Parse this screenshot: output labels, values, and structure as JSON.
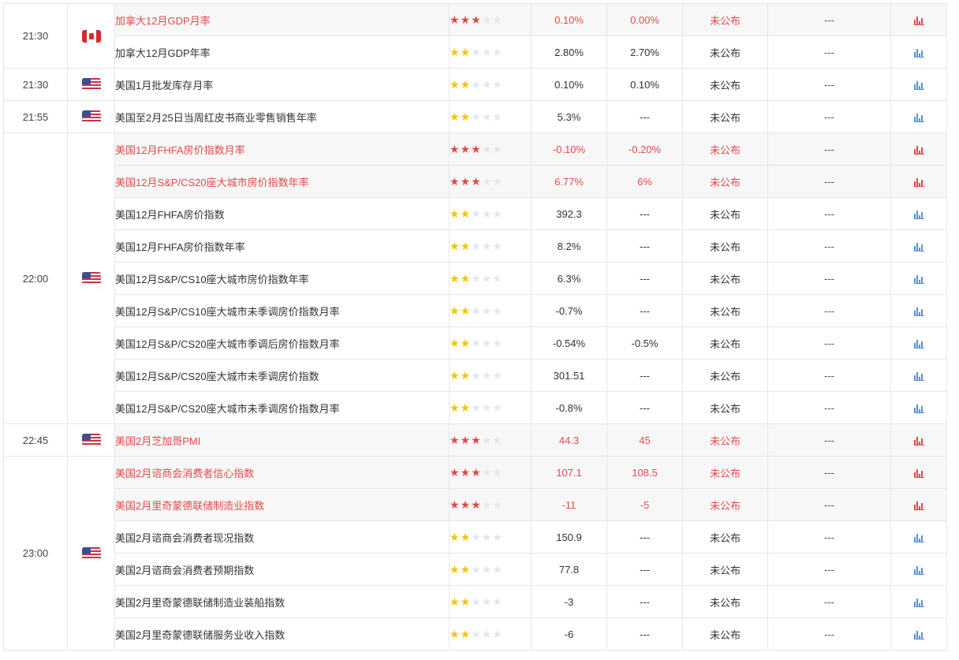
{
  "colors": {
    "highlight_text": "#e24b4b",
    "star_high": "#e34848",
    "star_mid": "#f5c400",
    "star_empty": "#e3e6ec",
    "chart_icon_high": "#e34848",
    "chart_icon_normal": "#5a8fe0",
    "row_highlight_bg": "#f7f7f7"
  },
  "groups": [
    {
      "time": "21:30",
      "flag": "canada-flag-icon",
      "rows": [
        {
          "name": "加拿大12月GDP月率",
          "stars": 3,
          "prev": "0.10%",
          "forecast": "0.00%",
          "actual": "未公布",
          "effect": "---",
          "important": true
        },
        {
          "name": "加拿大12月GDP年率",
          "stars": 2,
          "prev": "2.80%",
          "forecast": "2.70%",
          "actual": "未公布",
          "effect": "---",
          "important": false
        }
      ]
    },
    {
      "time": "21:30",
      "flag": "usa-flag-icon",
      "rows": [
        {
          "name": "美国1月批发库存月率",
          "stars": 2,
          "prev": "0.10%",
          "forecast": "0.10%",
          "actual": "未公布",
          "effect": "---",
          "important": false
        }
      ]
    },
    {
      "time": "21:55",
      "flag": "usa-flag-icon",
      "rows": [
        {
          "name": "美国至2月25日当周红皮书商业零售销售年率",
          "stars": 2,
          "prev": "5.3%",
          "forecast": "---",
          "actual": "未公布",
          "effect": "---",
          "important": false
        }
      ]
    },
    {
      "time": "22:00",
      "flag": "usa-flag-icon",
      "rows": [
        {
          "name": "美国12月FHFA房价指数月率",
          "stars": 3,
          "prev": "-0.10%",
          "forecast": "-0.20%",
          "actual": "未公布",
          "effect": "---",
          "important": true
        },
        {
          "name": "美国12月S&P/CS20座大城市房价指数年率",
          "stars": 3,
          "prev": "6.77%",
          "forecast": "6%",
          "actual": "未公布",
          "effect": "---",
          "important": true
        },
        {
          "name": "美国12月FHFA房价指数",
          "stars": 2,
          "prev": "392.3",
          "forecast": "---",
          "actual": "未公布",
          "effect": "---",
          "important": false
        },
        {
          "name": "美国12月FHFA房价指数年率",
          "stars": 2,
          "prev": "8.2%",
          "forecast": "---",
          "actual": "未公布",
          "effect": "---",
          "important": false
        },
        {
          "name": "美国12月S&P/CS10座大城市房价指数年率",
          "stars": 2,
          "prev": "6.3%",
          "forecast": "---",
          "actual": "未公布",
          "effect": "---",
          "important": false
        },
        {
          "name": "美国12月S&P/CS10座大城市未季调房价指数月率",
          "stars": 2,
          "prev": "-0.7%",
          "forecast": "---",
          "actual": "未公布",
          "effect": "---",
          "important": false
        },
        {
          "name": "美国12月S&P/CS20座大城市季调后房价指数月率",
          "stars": 2,
          "prev": "-0.54%",
          "forecast": "-0.5%",
          "actual": "未公布",
          "effect": "---",
          "important": false
        },
        {
          "name": "美国12月S&P/CS20座大城市未季调房价指数",
          "stars": 2,
          "prev": "301.51",
          "forecast": "---",
          "actual": "未公布",
          "effect": "---",
          "important": false
        },
        {
          "name": "美国12月S&P/CS20座大城市未季调房价指数月率",
          "stars": 2,
          "prev": "-0.8%",
          "forecast": "---",
          "actual": "未公布",
          "effect": "---",
          "important": false
        }
      ]
    },
    {
      "time": "22:45",
      "flag": "usa-flag-icon",
      "rows": [
        {
          "name": "美国2月芝加哥PMI",
          "stars": 3,
          "prev": "44.3",
          "forecast": "45",
          "actual": "未公布",
          "effect": "---",
          "important": true
        }
      ]
    },
    {
      "time": "23:00",
      "flag": "usa-flag-icon",
      "rows": [
        {
          "name": "美国2月谘商会消费者信心指数",
          "stars": 3,
          "prev": "107.1",
          "forecast": "108.5",
          "actual": "未公布",
          "effect": "---",
          "important": true
        },
        {
          "name": "美国2月里奇蒙德联储制造业指数",
          "stars": 3,
          "prev": "-11",
          "forecast": "-5",
          "actual": "未公布",
          "effect": "---",
          "important": true
        },
        {
          "name": "美国2月谘商会消费者现况指数",
          "stars": 2,
          "prev": "150.9",
          "forecast": "---",
          "actual": "未公布",
          "effect": "---",
          "important": false
        },
        {
          "name": "美国2月谘商会消费者预期指数",
          "stars": 2,
          "prev": "77.8",
          "forecast": "---",
          "actual": "未公布",
          "effect": "---",
          "important": false
        },
        {
          "name": "美国2月里奇蒙德联储制造业装船指数",
          "stars": 2,
          "prev": "-3",
          "forecast": "---",
          "actual": "未公布",
          "effect": "---",
          "important": false
        },
        {
          "name": "美国2月里奇蒙德联储服务业收入指数",
          "stars": 2,
          "prev": "-6",
          "forecast": "---",
          "actual": "未公布",
          "effect": "---",
          "important": false
        }
      ]
    }
  ]
}
